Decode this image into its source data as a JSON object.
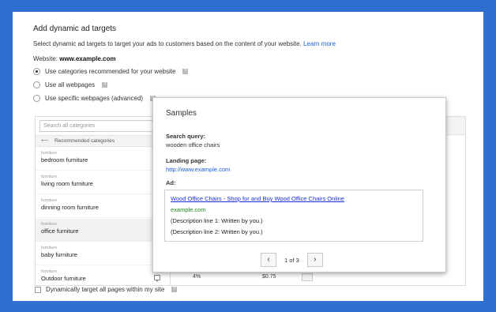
{
  "header": {
    "title": "Add dynamic ad targets",
    "intro": "Select dynamic ad targets to target your ads to customers based on the content of your website.",
    "learn_more": "Learn more",
    "website_label": "Website:",
    "website_value": "www.example.com"
  },
  "options": [
    {
      "label": "Use categories recommended for your website",
      "checked": true
    },
    {
      "label": "Use all webpages",
      "checked": false
    },
    {
      "label": "Use specific webpages (advanced)",
      "checked": false
    }
  ],
  "categories": {
    "search_placeholder": "Search all categories",
    "recommended_label": "Recommended categories",
    "items": [
      {
        "group": "furniture",
        "name": "bedroom furniture"
      },
      {
        "group": "furniture",
        "name": "living room furniture"
      },
      {
        "group": "furniture",
        "name": "dinning room furniture"
      },
      {
        "group": "furniture",
        "name": "office furniture"
      },
      {
        "group": "furniture",
        "name": "baby furniture"
      },
      {
        "group": "furniture",
        "name": "Outdoor furniture"
      }
    ]
  },
  "partial_row": {
    "col1": "4%",
    "col2": "$0.75"
  },
  "samples": {
    "title": "Samples",
    "search_query_label": "Search query:",
    "search_query_value": "wooden office chairs",
    "landing_page_label": "Landing page:",
    "landing_page_value": "http://www.example.com",
    "ad_label": "Ad:",
    "ad": {
      "headline": "Wood Office Chairs - Shop for and Buy Wood Office Chairs Online",
      "display_url": "example.com",
      "desc1": "(Description line 1: Written by you.)",
      "desc2": "(Description line 2: Written by you.)"
    },
    "pager": {
      "prev": "‹",
      "count": "1 of 3",
      "next": "›"
    }
  },
  "footer": {
    "target_all_label": "Dynamically target all pages within my site"
  },
  "colors": {
    "background": "#2f6fd0",
    "link": "#1a5fd6",
    "ad_headline": "#1a2fd6",
    "ad_url": "#1d8a1d"
  }
}
